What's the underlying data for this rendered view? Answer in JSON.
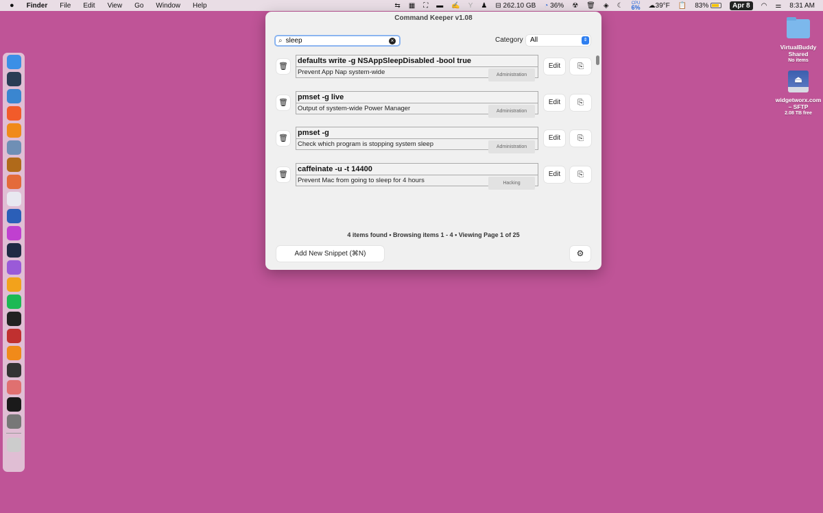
{
  "menubar": {
    "apple": "",
    "app": "Finder",
    "items": [
      "File",
      "Edit",
      "View",
      "Go",
      "Window",
      "Help"
    ],
    "status": {
      "disk": "262.10 GB",
      "progress": "36%",
      "cpu_label": "CPU",
      "cpu": "6%",
      "weather": "39°F",
      "battery": "83%",
      "date": "Apr 8",
      "time": "8:31 AM"
    }
  },
  "window": {
    "title": "Command Keeper v1.08",
    "search": {
      "value": "sleep"
    },
    "category": {
      "label": "Category",
      "value": "All"
    },
    "snippets": [
      {
        "command": "defaults write -g NSAppSleepDisabled -bool true",
        "description": "Prevent App Nap system-wide",
        "category": "Administration"
      },
      {
        "command": "pmset -g live",
        "description": "Output of system-wide Power Manager",
        "category": "Administration"
      },
      {
        "command": "pmset -g",
        "description": "Check which program is stopping system sleep",
        "category": "Administration"
      },
      {
        "command": "caffeinate -u -t 14400",
        "description": "Prevent Mac from going to sleep for 4 hours",
        "category": "Hacking"
      }
    ],
    "edit_label": "Edit",
    "status": "4 items found • Browsing items 1 - 4 • Viewing Page 1 of 25",
    "add_label": "Add New Snippet (⌘N)"
  },
  "desktop": [
    {
      "name": "VirtualBuddy Shared",
      "info": "No items"
    },
    {
      "name": "widgetworx.com – SFTP",
      "info": "2.08 TB free"
    }
  ],
  "dock_colors": [
    "#3b8fe6",
    "#2a3d55",
    "#3a86d0",
    "#f25b2a",
    "#f08a1a",
    "#6f8fb5",
    "#b06a1a",
    "#e46a3a",
    "#e8e8f0",
    "#2b5fb8",
    "#c040d0",
    "#1f2a44",
    "#9a5ad8",
    "#f3a21b",
    "#1db954",
    "#222222",
    "#c03030",
    "#f08a1a",
    "#333333",
    "#e07070",
    "#1a1a1a",
    "#777777",
    "#cccccc"
  ]
}
